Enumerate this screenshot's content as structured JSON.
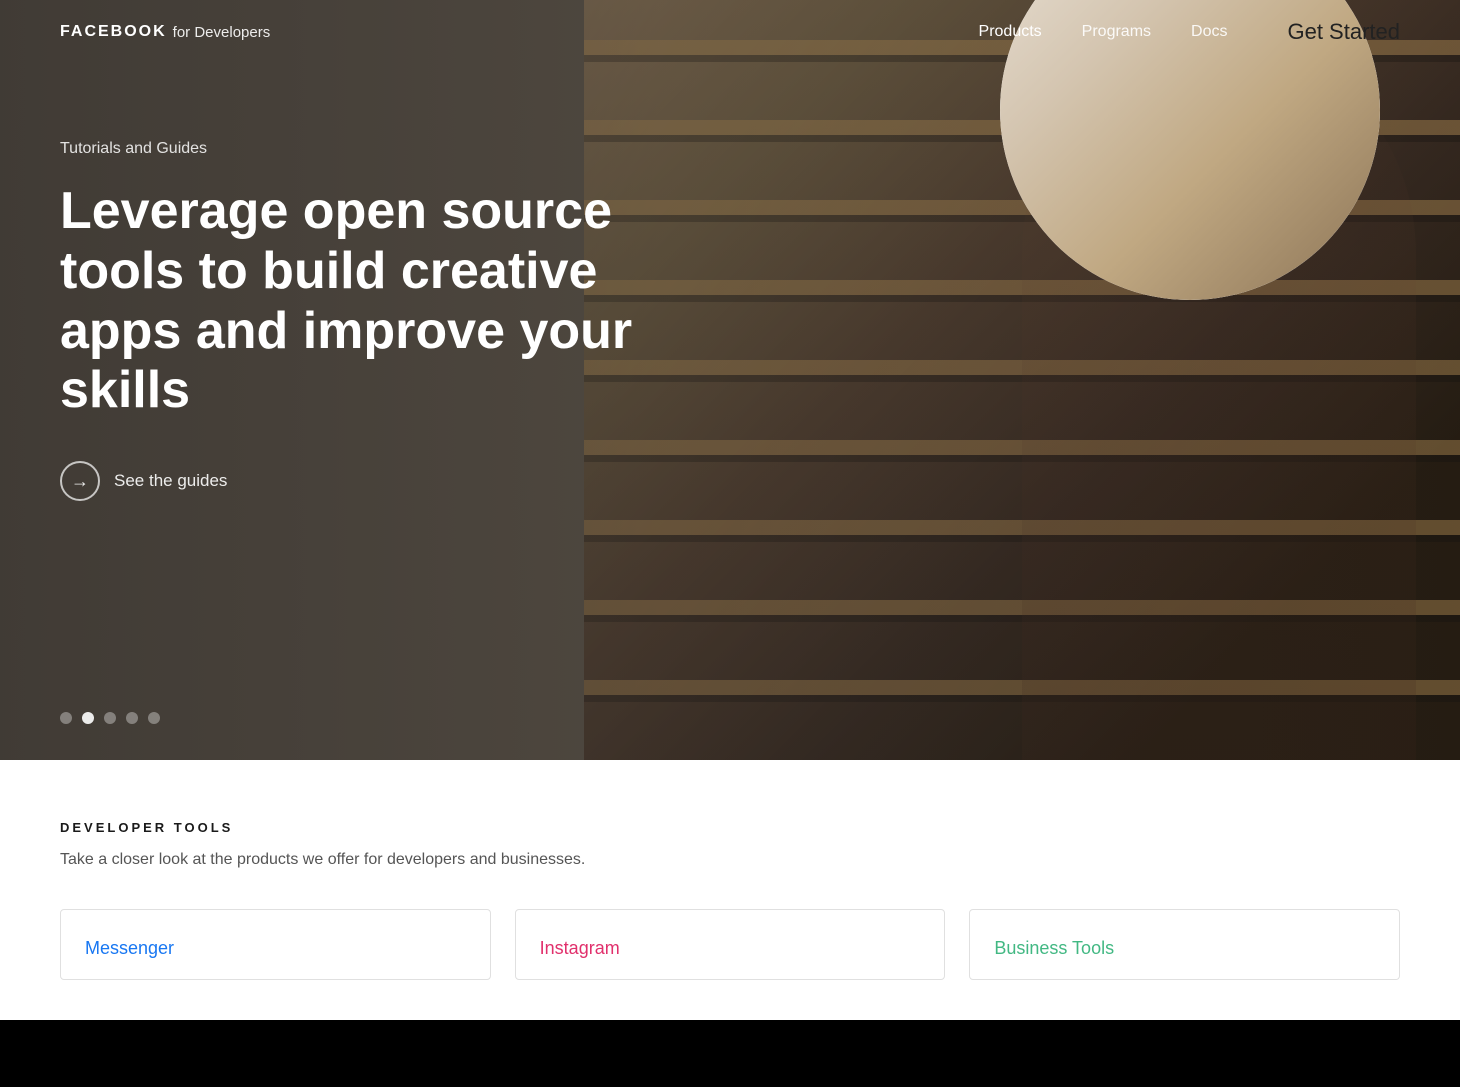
{
  "page": {
    "background": "#000"
  },
  "nav": {
    "logo_facebook": "FACEBOOK",
    "logo_sub": "for Developers",
    "links": [
      {
        "label": "Products",
        "active": true
      },
      {
        "label": "Programs",
        "active": false
      },
      {
        "label": "Docs",
        "active": false
      }
    ],
    "get_started": "Get Started"
  },
  "hero": {
    "subtitle": "Tutorials and Guides",
    "title": "Leverage open source tools to build creative apps and improve your skills",
    "cta_label": "See the guides",
    "dots": [
      {
        "active": false
      },
      {
        "active": true
      },
      {
        "active": false
      },
      {
        "active": false
      },
      {
        "active": false
      }
    ]
  },
  "below": {
    "section_label": "DEVELOPER TOOLS",
    "section_desc": "Take a closer look at the products we offer for developers and businesses.",
    "cards": [
      {
        "title": "Messenger",
        "color_class": "messenger"
      },
      {
        "title": "Instagram",
        "color_class": "instagram"
      },
      {
        "title": "Business Tools",
        "color_class": "business"
      }
    ]
  }
}
